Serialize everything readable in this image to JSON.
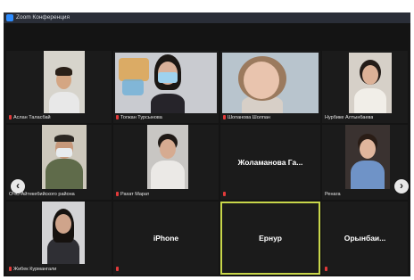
{
  "window": {
    "title": "Zoom Конференция"
  },
  "participants": [
    {
      "name": "Аслан Таласбай"
    },
    {
      "name": "Тогжан Турсынова"
    },
    {
      "name": "Шопанова Шолпан"
    },
    {
      "name": "Нурбике Алтынбаева"
    },
    {
      "name": "ОЧС-Айтекебийского района"
    },
    {
      "name": "Рахат Марат"
    },
    {
      "name": "Жоламанова Га..."
    },
    {
      "name": "Ренага"
    },
    {
      "name": "Жибек Курмангали"
    },
    {
      "name": "iPhone"
    },
    {
      "name": "Ернур"
    },
    {
      "name": "Орынбаи..."
    }
  ],
  "nav": {
    "prev": "‹",
    "next": "›"
  }
}
